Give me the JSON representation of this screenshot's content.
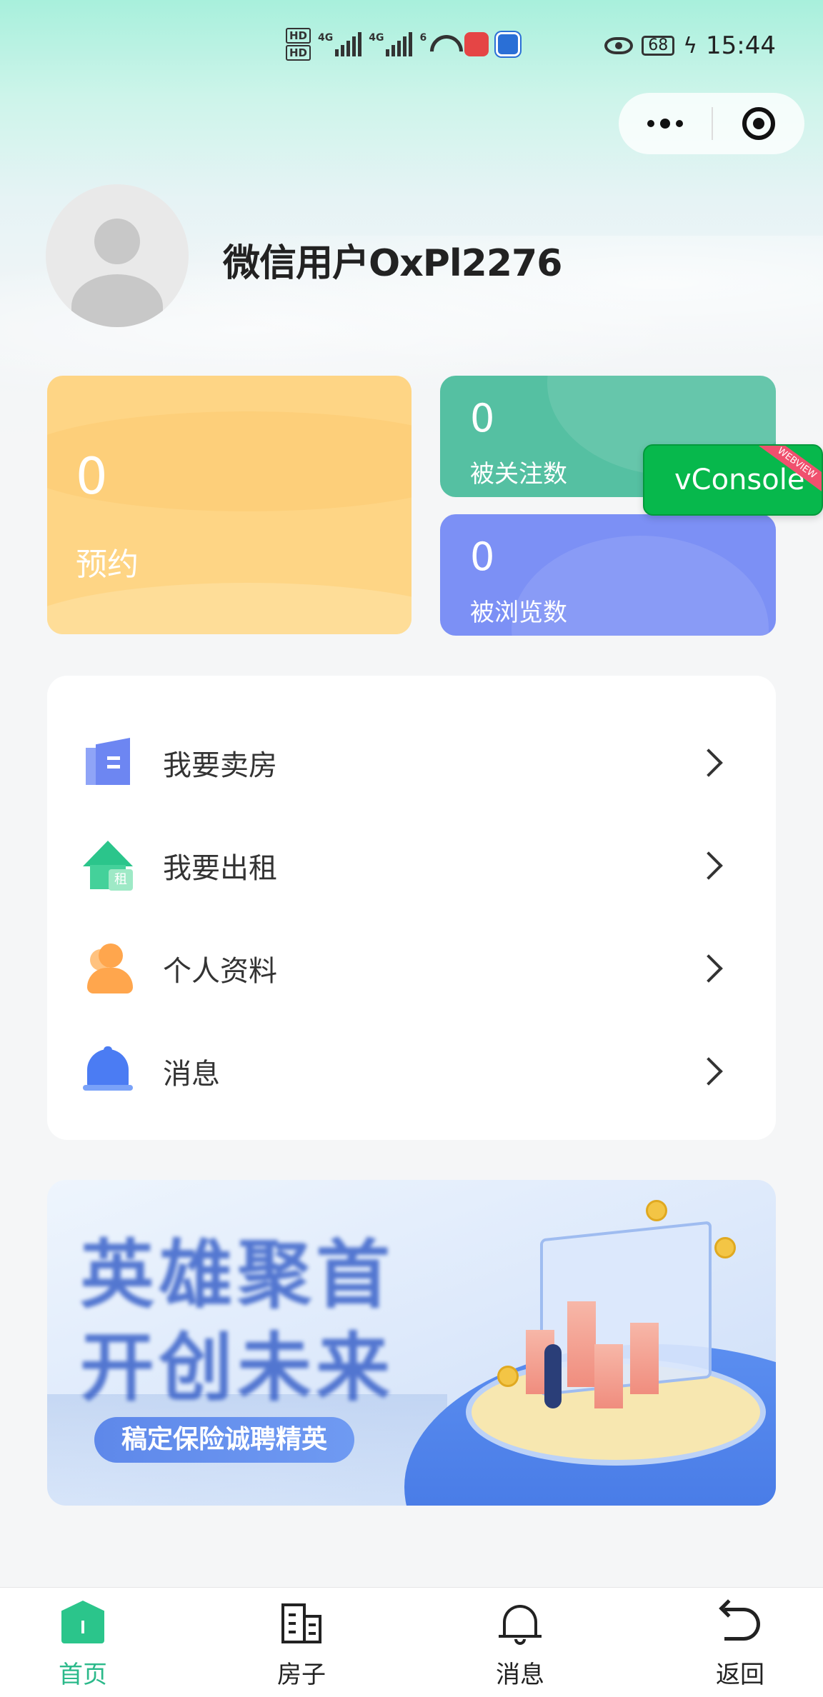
{
  "status_bar": {
    "time": "15:44",
    "battery": "68",
    "network_1": "4G",
    "network_2": "4G",
    "hd_1": "HD",
    "hd_2": "HD",
    "wifi_label": "6"
  },
  "profile": {
    "username": "微信用户OxPl2276"
  },
  "stats": {
    "booking": {
      "value": "0",
      "label": "预约"
    },
    "followed": {
      "value": "0",
      "label": "被关注数"
    },
    "viewed": {
      "value": "0",
      "label": "被浏览数"
    }
  },
  "vconsole": {
    "label": "vConsole",
    "ribbon": "WEBVIEW"
  },
  "menu": {
    "items": [
      {
        "label": "我要卖房",
        "icon": "sell-house-icon"
      },
      {
        "label": "我要出租",
        "icon": "rent-house-icon"
      },
      {
        "label": "个人资料",
        "icon": "profile-icon"
      },
      {
        "label": "消息",
        "icon": "bell-icon"
      }
    ]
  },
  "banner": {
    "headline_1": "英雄聚首",
    "headline_2": "开创未来",
    "pill": "稿定保险诚聘精英"
  },
  "tabbar": {
    "items": [
      {
        "label": "首页",
        "active": true
      },
      {
        "label": "房子",
        "active": false
      },
      {
        "label": "消息",
        "active": false
      },
      {
        "label": "返回",
        "active": false
      }
    ]
  },
  "colors": {
    "accent": "#2bb98a",
    "booking_card": "#fed585",
    "followed_card": "#55c0a2",
    "viewed_card": "#7c90f5",
    "vconsole": "#07b84c"
  }
}
